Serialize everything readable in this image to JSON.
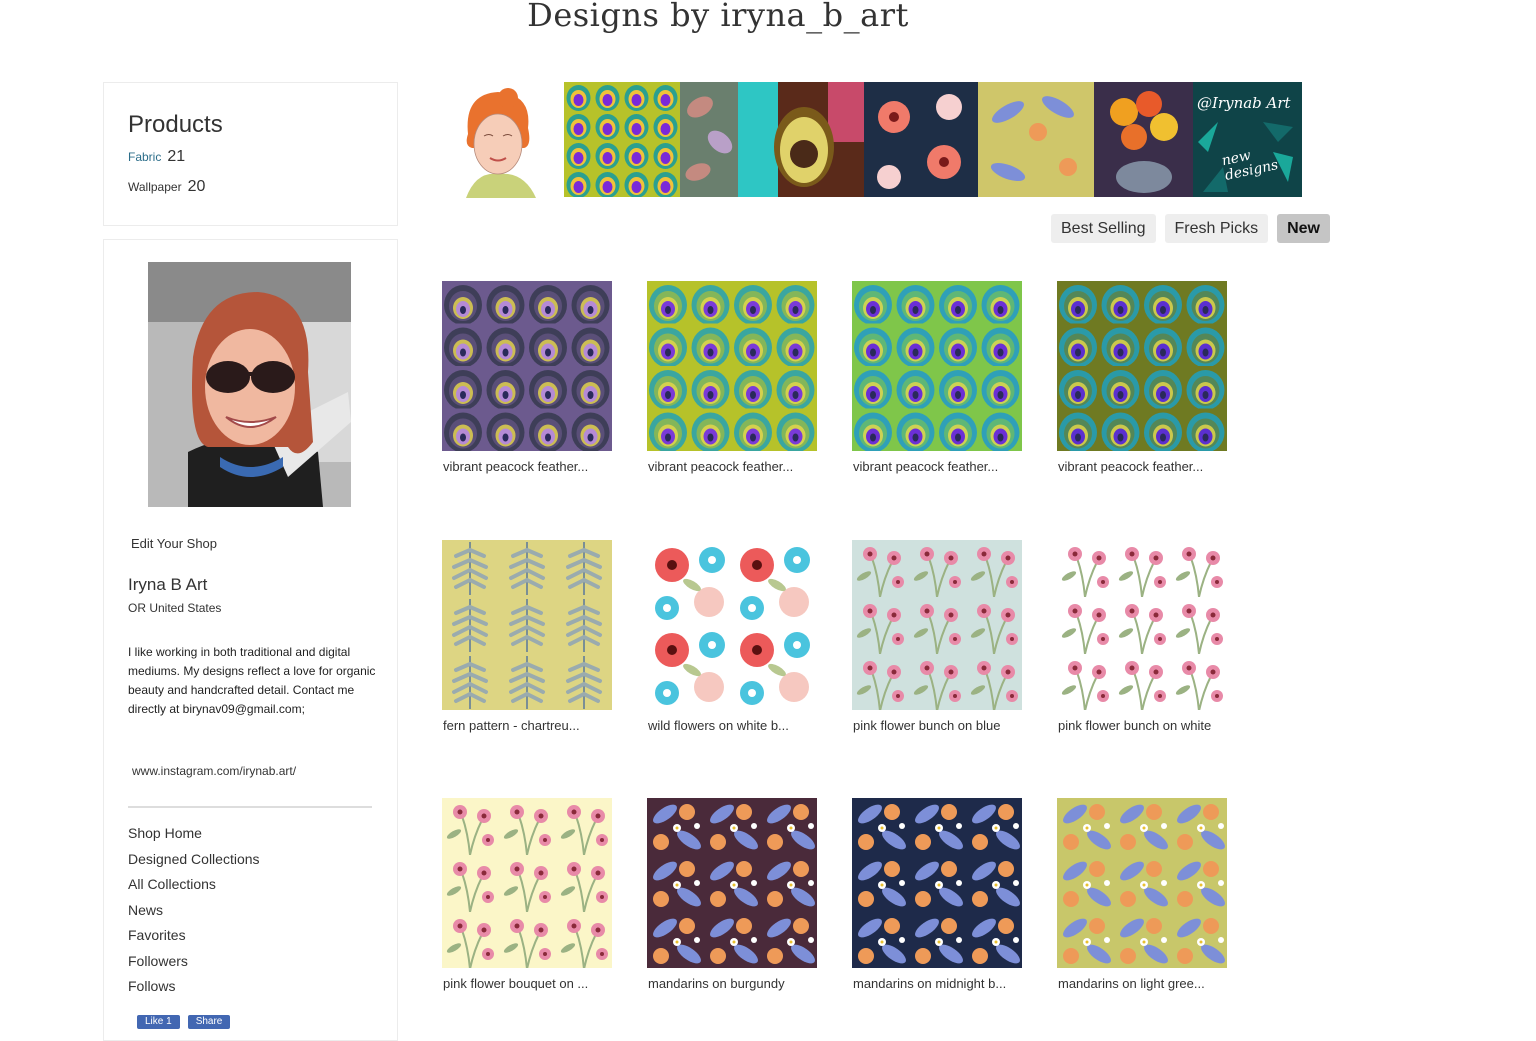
{
  "page": {
    "title": "Designs by iryna_b_art"
  },
  "products": {
    "title": "Products",
    "items": [
      {
        "label": "Fabric",
        "count": "21"
      },
      {
        "label": "Wallpaper",
        "count": "20"
      }
    ]
  },
  "profile": {
    "edit_shop": "Edit Your Shop",
    "name": "Iryna B Art",
    "location": "OR United States",
    "bio": "I like working in both traditional and digital mediums. My designs reflect a love for organic beauty and handcrafted detail. Contact me directly at birynav09@gmail.com;",
    "instagram": "www.instagram.com/irynab.art/"
  },
  "nav": {
    "items": [
      "Shop Home",
      "Designed Collections",
      "All Collections",
      "News",
      "Favorites",
      "Followers",
      "Follows"
    ]
  },
  "social": {
    "like": "Like 1",
    "share": "Share"
  },
  "banner": {
    "sign_text": "@Irynab Art",
    "sign_sub": "new designs"
  },
  "tabs": [
    {
      "label": "Best Selling",
      "active": false
    },
    {
      "label": "Fresh Picks",
      "active": false
    },
    {
      "label": "New",
      "active": true
    }
  ],
  "designs": [
    {
      "title": "vibrant peacock feather...",
      "pattern": "peacock",
      "colors": [
        "#6c5a8e",
        "#b58ad6",
        "#3e3e58"
      ]
    },
    {
      "title": "vibrant peacock feather...",
      "pattern": "peacock",
      "colors": [
        "#b6c22a",
        "#7a3ad8",
        "#3aa6a0"
      ]
    },
    {
      "title": "vibrant peacock feather...",
      "pattern": "peacock",
      "colors": [
        "#7fc64a",
        "#6b2fd6",
        "#2fa0b8"
      ]
    },
    {
      "title": "vibrant peacock feather...",
      "pattern": "peacock",
      "colors": [
        "#6f7a22",
        "#5b2fd0",
        "#2a9aa8"
      ]
    },
    {
      "title": "fern pattern - chartreu...",
      "pattern": "fern",
      "colors": [
        "#ddd583",
        "#7a8f95",
        "#9aabae"
      ]
    },
    {
      "title": "wild flowers on white b...",
      "pattern": "wild",
      "colors": [
        "#ffffff",
        "#ec5a5a",
        "#4ac4de"
      ]
    },
    {
      "title": "pink flower bunch on blue",
      "pattern": "pinkbunch",
      "colors": [
        "#cfe1de",
        "#e88aa8",
        "#9bb283"
      ]
    },
    {
      "title": "pink flower bunch on white",
      "pattern": "pinkbunch",
      "colors": [
        "#ffffff",
        "#e88aa8",
        "#9bb283"
      ]
    },
    {
      "title": "pink flower bouquet on ...",
      "pattern": "pinkbunch",
      "colors": [
        "#fbf6c8",
        "#e88aa8",
        "#9bb283"
      ]
    },
    {
      "title": "mandarins on burgundy",
      "pattern": "mandarin",
      "colors": [
        "#4a2a3a",
        "#ee9a58",
        "#7d8fd8"
      ]
    },
    {
      "title": "mandarins on midnight b...",
      "pattern": "mandarin",
      "colors": [
        "#1e2a4a",
        "#ee9a58",
        "#7d8fd8"
      ]
    },
    {
      "title": "mandarins on light gree...",
      "pattern": "mandarin",
      "colors": [
        "#c8c76a",
        "#ee9a58",
        "#7d8fd8"
      ]
    }
  ]
}
